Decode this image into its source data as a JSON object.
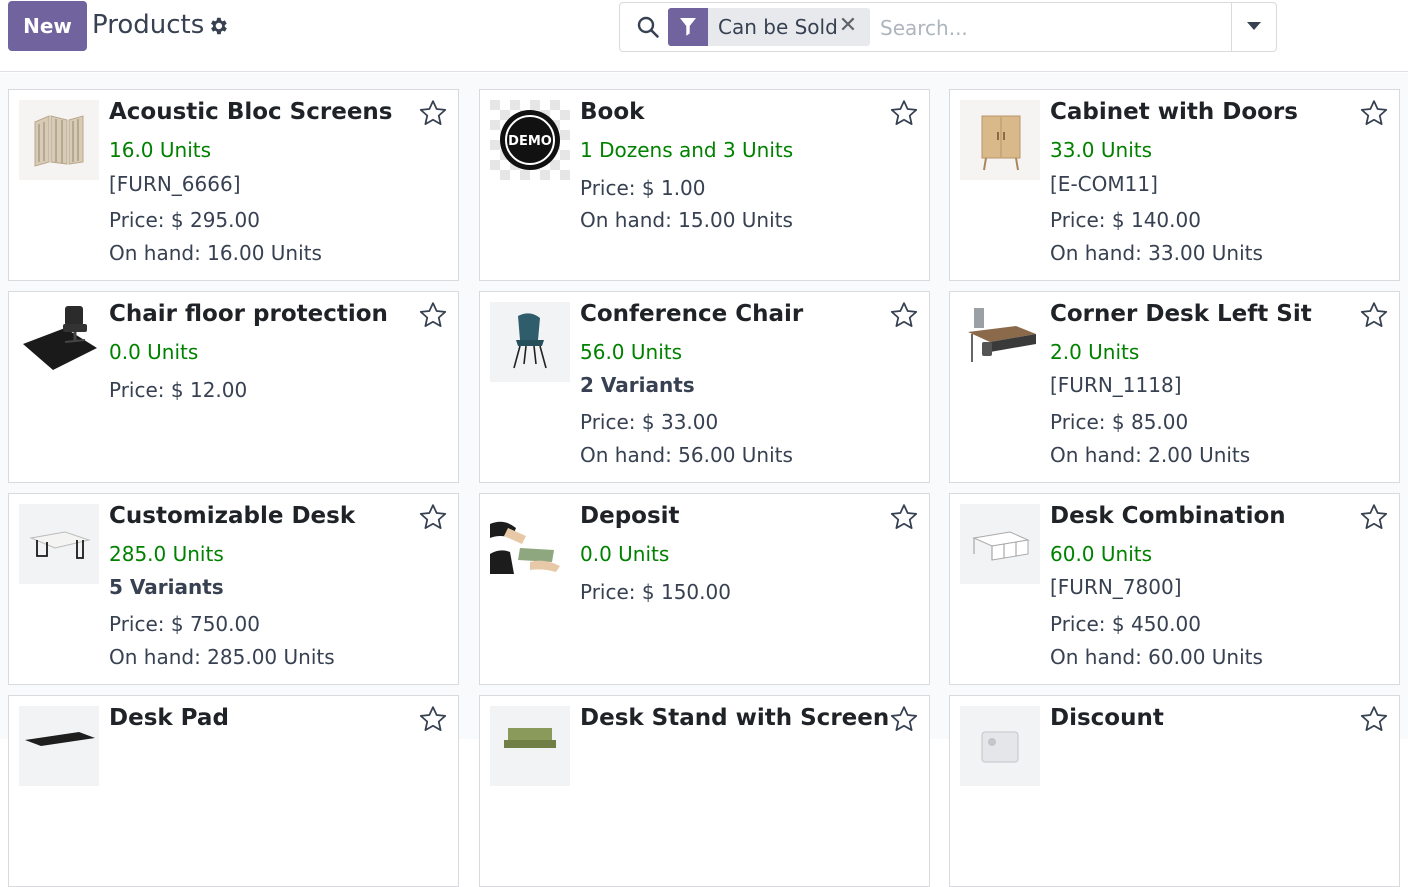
{
  "control_panel": {
    "new_label": "New",
    "title": "Products",
    "gear_icon": "gear-icon",
    "search": {
      "facet_label": "Can be Sold",
      "facet_remove": "✕",
      "placeholder": "Search..."
    }
  },
  "colors": {
    "brand": "#71639e",
    "quantity": "#018100",
    "background": "#f9fafb"
  },
  "products": [
    {
      "name": "Acoustic Bloc Screens",
      "qty": "16.0 Units",
      "ref": "[FURN_6666]",
      "price": "Price: $ 295.00",
      "onhand": "On hand: 16.00 Units"
    },
    {
      "name": "Book",
      "qty": "1 Dozens and 3 Units",
      "price": "Price: $ 1.00",
      "onhand": "On hand: 15.00 Units"
    },
    {
      "name": "Cabinet with Doors",
      "qty": "33.0 Units",
      "ref": "[E-COM11]",
      "price": "Price: $ 140.00",
      "onhand": "On hand: 33.00 Units"
    },
    {
      "name": "Chair floor protection",
      "qty": "0.0 Units",
      "price": "Price: $ 12.00"
    },
    {
      "name": "Conference Chair",
      "qty": "56.0 Units",
      "variants": "2 Variants",
      "price": "Price: $ 33.00",
      "onhand": "On hand: 56.00 Units"
    },
    {
      "name": "Corner Desk Left Sit",
      "qty": "2.0 Units",
      "ref": "[FURN_1118]",
      "price": "Price: $ 85.00",
      "onhand": "On hand: 2.00 Units"
    },
    {
      "name": "Customizable Desk",
      "qty": "285.0 Units",
      "variants": "5 Variants",
      "price": "Price: $ 750.00",
      "onhand": "On hand: 285.00 Units"
    },
    {
      "name": "Deposit",
      "qty": "0.0 Units",
      "price": "Price: $ 150.00"
    },
    {
      "name": "Desk Combination",
      "qty": "60.0 Units",
      "ref": "[FURN_7800]",
      "price": "Price: $ 450.00",
      "onhand": "On hand: 60.00 Units"
    },
    {
      "name": "Desk Pad"
    },
    {
      "name": "Desk Stand with Screen"
    },
    {
      "name": "Discount"
    }
  ]
}
